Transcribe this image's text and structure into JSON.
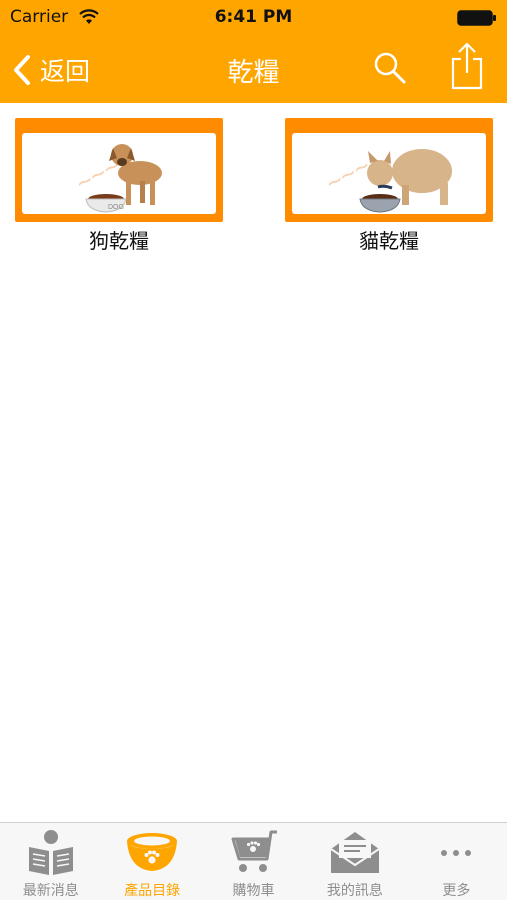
{
  "status_bar": {
    "carrier": "Carrier",
    "time": "6:41 PM"
  },
  "nav": {
    "back_label": "返回",
    "title": "乾糧"
  },
  "products": [
    {
      "label": "狗乾糧",
      "bowl_text": "DOG",
      "icon": "dog-food-image"
    },
    {
      "label": "貓乾糧",
      "icon": "cat-food-image"
    }
  ],
  "tabs": [
    {
      "label": "最新消息",
      "icon": "newspaper-icon",
      "active": false
    },
    {
      "label": "產品目錄",
      "icon": "pet-bowl-icon",
      "active": true
    },
    {
      "label": "購物車",
      "icon": "shopping-cart-icon",
      "active": false
    },
    {
      "label": "我的訊息",
      "icon": "mail-icon",
      "active": false
    },
    {
      "label": "更多",
      "icon": "more-icon",
      "active": false
    }
  ],
  "colors": {
    "accent": "#FFA500",
    "tab_inactive": "#8E8E8E",
    "card_frame": "#FF8C00"
  }
}
